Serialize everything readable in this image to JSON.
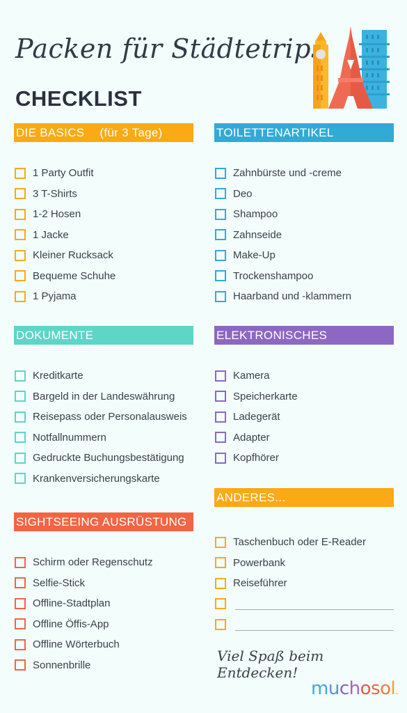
{
  "header": {
    "title_script": "Packen für Städtetrips",
    "title_main": "CHECKLIST",
    "illustration": "city-landmarks-icon"
  },
  "sections": {
    "basics": {
      "title": "DIE BASICS",
      "subtitle": "(für 3 Tage)",
      "color": "#fba914",
      "items": [
        "1 Party Outfit",
        "3 T-Shirts",
        "1-2 Hosen",
        "1 Jacke",
        "Kleiner Rucksack",
        "Bequeme Schuhe",
        "1 Pyjama"
      ]
    },
    "toiletries": {
      "title": "TOILETTENARTIKEL",
      "color": "#32aad6",
      "items": [
        "Zahnbürste und -creme",
        "Deo",
        "Shampoo",
        "Zahnseide",
        "Make-Up",
        "Trockenshampoo",
        "Haarband und -klammern"
      ]
    },
    "documents": {
      "title": "DOKUMENTE",
      "color": "#5dd6c6",
      "items": [
        "Kreditkarte",
        "Bargeld in der Landeswährung",
        "Reisepass oder Personalausweis",
        "Notfallnummern",
        "Gedruckte Buchungsbestätigung",
        "Krankenversicherungskarte"
      ]
    },
    "electronics": {
      "title": "ELEKTRONISCHES",
      "color": "#8d67c4",
      "items": [
        "Kamera",
        "Speicherkarte",
        "Ladegerät",
        "Adapter",
        "Kopfhörer"
      ]
    },
    "sightseeing": {
      "title": "SIGHTSEEING AUSRÜSTUNG",
      "color": "#f26444",
      "items": [
        "Schirm oder Regenschutz",
        "Selfie-Stick",
        "Offline-Stadtplan",
        "Offline Öffis-App",
        "Offline Wörterbuch",
        "Sonnenbrille"
      ]
    },
    "other": {
      "title": "ANDERES...",
      "color": "#fba914",
      "items": [
        "Taschenbuch oder E-Reader",
        "Powerbank",
        "Reiseführer"
      ],
      "blank_lines": 2
    }
  },
  "footer": {
    "tagline": "Viel Spaß beim Entdecken!",
    "logo": {
      "letters": [
        "m",
        "u",
        "c",
        "h",
        "o",
        "s",
        "o",
        "l",
        "."
      ],
      "colors": [
        "#3aa8d8",
        "#5b8fd6",
        "#8a62c4",
        "#b45fb4",
        "#e4584c",
        "#ef6446",
        "#f47a3a",
        "#f89e28",
        "#fbb52a"
      ]
    }
  }
}
